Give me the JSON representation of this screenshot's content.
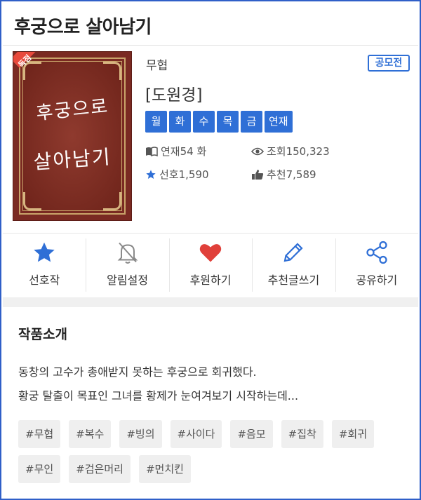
{
  "header": {
    "title": "후궁으로 살아남기"
  },
  "cover": {
    "badge": "독점",
    "line1": "후궁으로",
    "line2": "살아남기"
  },
  "info": {
    "genre": "무협",
    "contest_badge": "공모전",
    "author": "[도원경]",
    "days": [
      "월",
      "화",
      "수",
      "목",
      "금",
      "연재"
    ],
    "episodes": "연재54 화",
    "views": "조회150,323",
    "favorites": "선호1,590",
    "recommends": "추천7,589"
  },
  "actions": [
    {
      "label": "선호작",
      "icon": "star-icon"
    },
    {
      "label": "알림설정",
      "icon": "bell-off-icon"
    },
    {
      "label": "후원하기",
      "icon": "heart-icon"
    },
    {
      "label": "추천글쓰기",
      "icon": "pencil-icon"
    },
    {
      "label": "공유하기",
      "icon": "share-icon"
    }
  ],
  "intro": {
    "title": "작품소개",
    "lines": [
      "동창의 고수가 총애받지 못하는 후궁으로 회귀했다.",
      "황궁 탈출이 목표인 그녀를 황제가 눈여겨보기 시작하는데..."
    ],
    "tags": [
      "#무협",
      "#복수",
      "#빙의",
      "#사이다",
      "#음모",
      "#집착",
      "#회귀",
      "#무인",
      "#검은머리",
      "#먼치킨"
    ]
  },
  "colors": {
    "accent": "#2f6fd6",
    "heart": "#e0403a",
    "cover": "#7a2a22",
    "ribbon": "#e84a3c"
  }
}
